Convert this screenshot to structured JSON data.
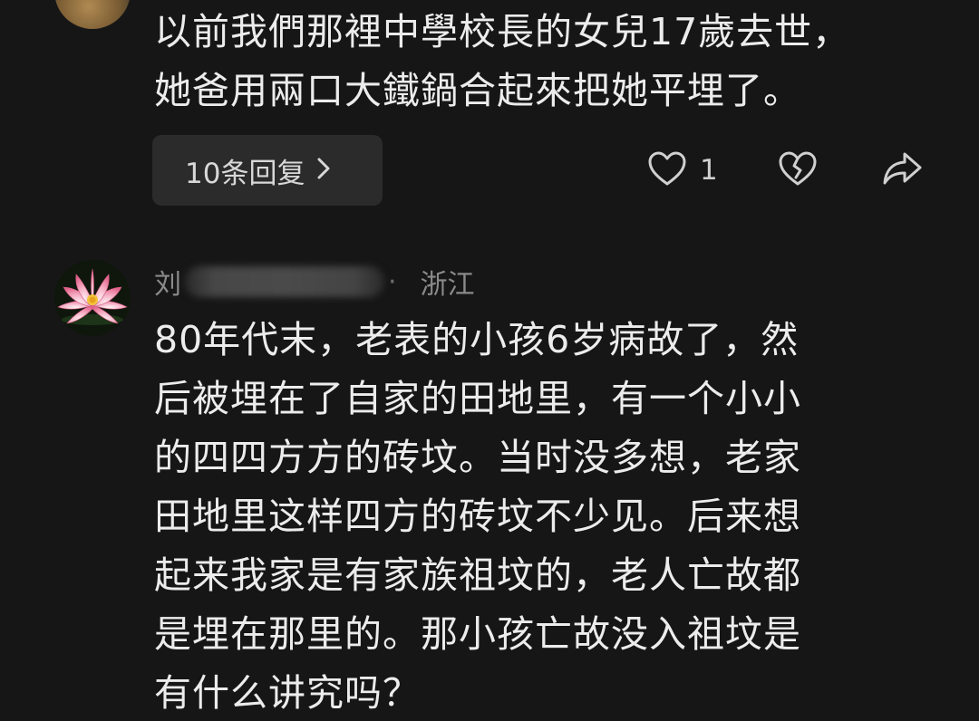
{
  "comments": [
    {
      "text_lines": [
        "以前我們那裡中學校長的女兒17歲去世，",
        "她爸用兩口大鐵鍋合起來把她平埋了。"
      ],
      "reply_label": "10条回复",
      "like_count": "1",
      "icons": {
        "reply": "chevron-right-icon",
        "like": "heart-icon",
        "dislike": "broken-heart-icon",
        "share": "share-arrow-icon"
      }
    },
    {
      "username_visible": "刘",
      "username_redacted": true,
      "location": "浙江",
      "avatar": "lotus-flower",
      "text_lines": [
        "80年代末，老表的小孩6岁病故了，然",
        "后被埋在了自家的田地里，有一个小小",
        "的四四方方的砖坟。当时没多想，老家",
        "田地里这样四方的砖坟不少见。后来想",
        "起来我家是有家族祖坟的，老人亡故都",
        "是埋在那里的。那小孩亡故没入祖坟是",
        "有什么讲究吗？"
      ]
    }
  ],
  "colors": {
    "background": "#161616",
    "text": "#ececec",
    "muted": "#8a8a8a",
    "button_bg": "#2b2b2b"
  }
}
